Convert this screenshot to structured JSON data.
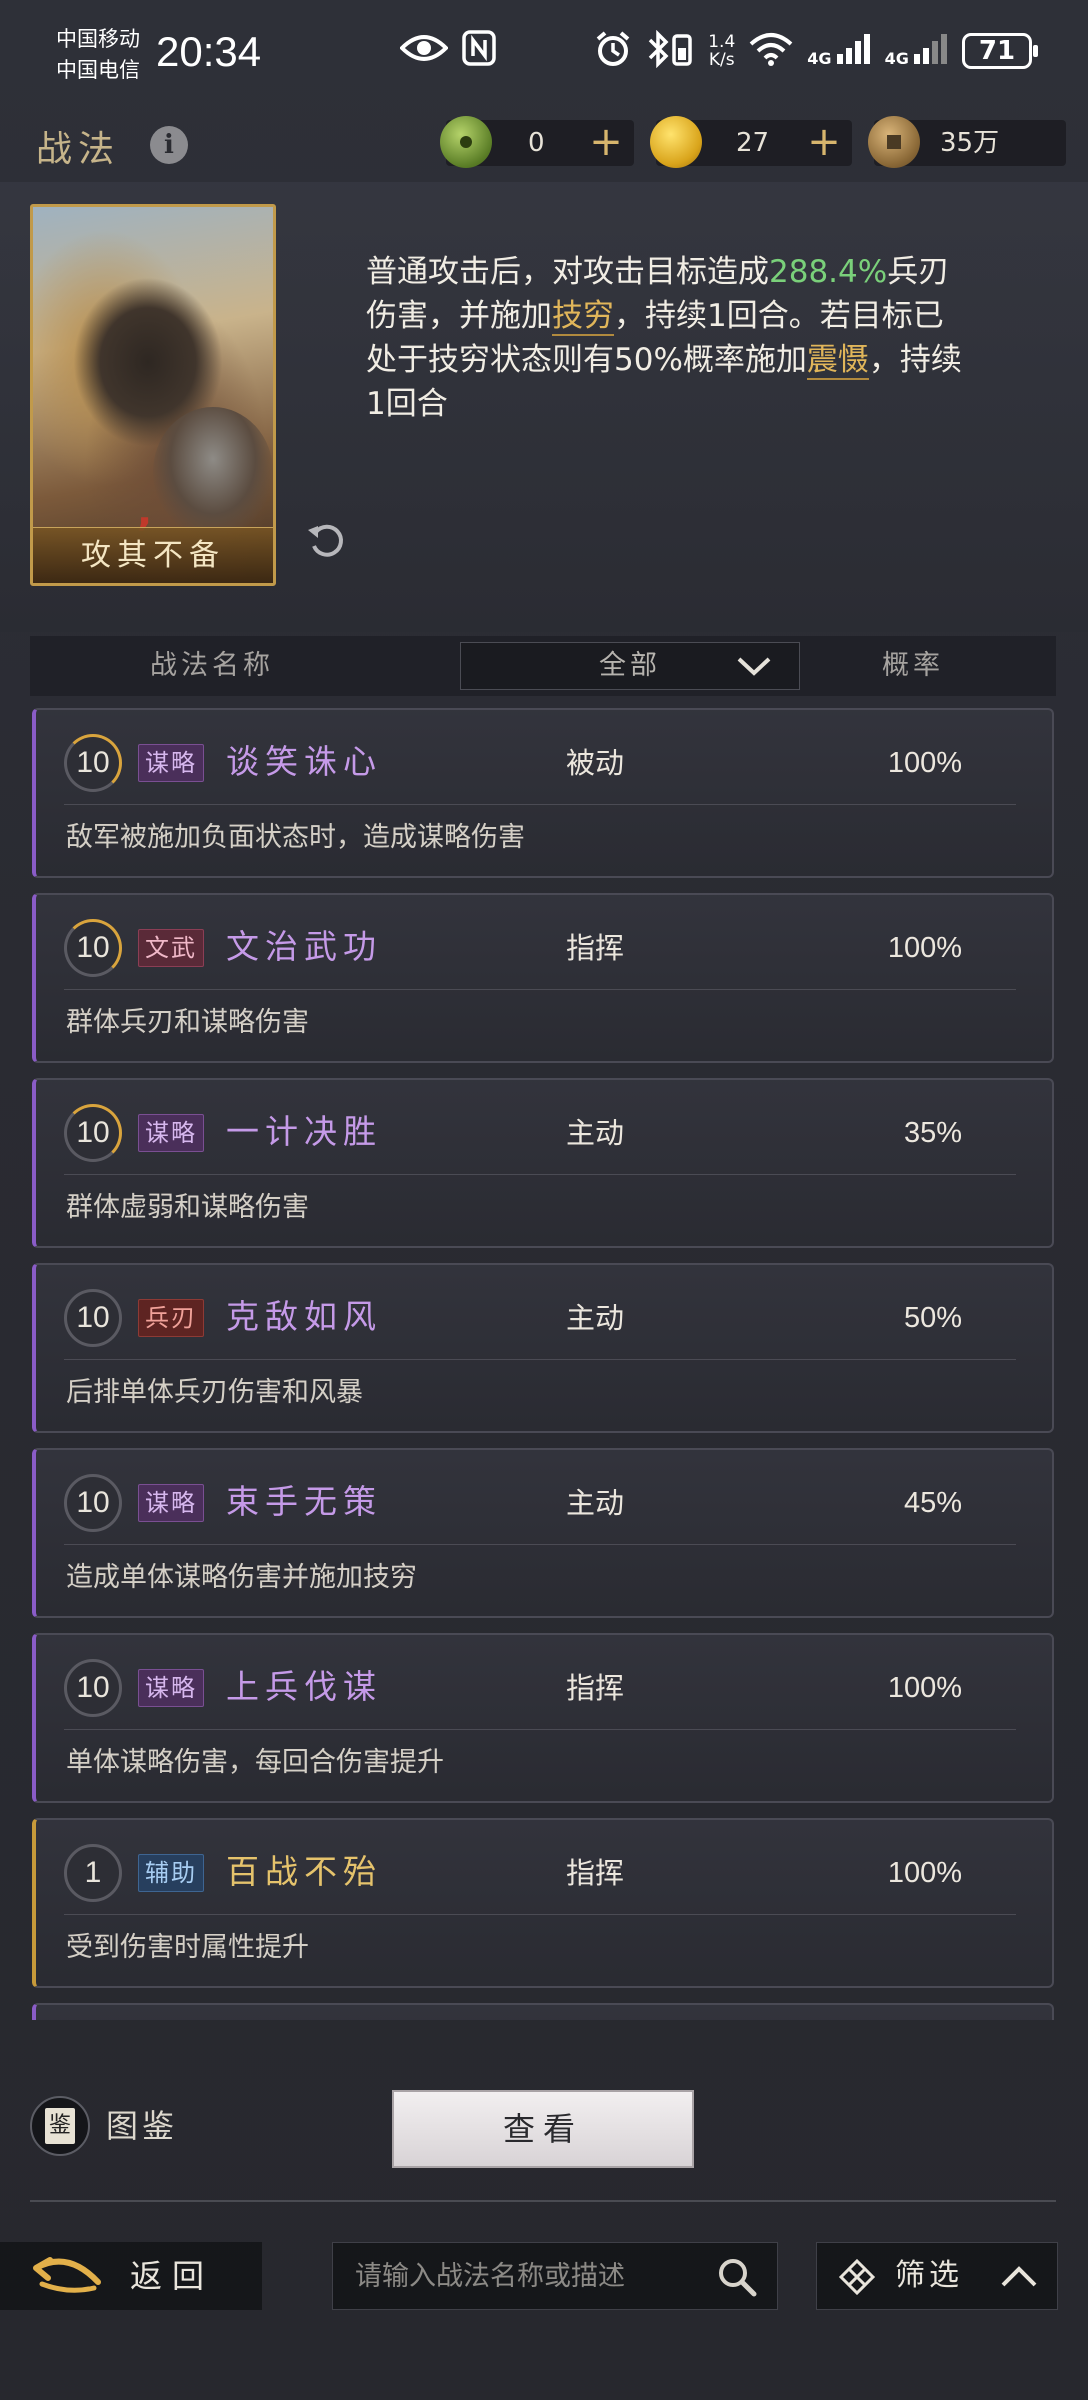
{
  "status": {
    "carrier1": "中国移动",
    "carrier2": "中国电信",
    "time": "20:34",
    "net_speed_top": "1.4",
    "net_speed_bottom": "K/s",
    "sig1": "4G",
    "sig2": "4G",
    "battery": "71"
  },
  "header": {
    "title": "战法",
    "currencies": [
      {
        "name": "jade-coin-icon",
        "value": "0"
      },
      {
        "name": "gold-coin-icon",
        "value": "27"
      },
      {
        "name": "copper-coin-icon",
        "value": "35万"
      }
    ]
  },
  "detail": {
    "card_name": "攻其不备",
    "desc_parts": [
      "普通攻击后，对攻击目标造成",
      "288.4%",
      "兵刃伤害，并施加",
      "技穷",
      "，持续1回合。若目标已处于技穷状态则有50%概率施加",
      "震慑",
      "，持续1回合"
    ]
  },
  "list_header": {
    "name_col": "战法名称",
    "filter": "全部",
    "rate_col": "概率"
  },
  "skills": [
    {
      "level": "10",
      "tag": "谋略",
      "name": "谈笑诛心",
      "type": "被动",
      "rate": "100%",
      "desc": "敌军被施加负面状态时，造成谋略伤害"
    },
    {
      "level": "10",
      "tag": "文武",
      "name": "文治武功",
      "type": "指挥",
      "rate": "100%",
      "desc": "群体兵刃和谋略伤害"
    },
    {
      "level": "10",
      "tag": "谋略",
      "name": "一计决胜",
      "type": "主动",
      "rate": "35%",
      "desc": "群体虚弱和谋略伤害"
    },
    {
      "level": "10",
      "tag": "兵刃",
      "name": "克敌如风",
      "type": "主动",
      "rate": "50%",
      "desc": "后排单体兵刃伤害和风暴"
    },
    {
      "level": "10",
      "tag": "谋略",
      "name": "束手无策",
      "type": "主动",
      "rate": "45%",
      "desc": "造成单体谋略伤害并施加技穷"
    },
    {
      "level": "10",
      "tag": "谋略",
      "name": "上兵伐谋",
      "type": "指挥",
      "rate": "100%",
      "desc": "单体谋略伤害，每回合伤害提升"
    },
    {
      "level": "1",
      "tag": "辅助",
      "name": "百战不殆",
      "type": "指挥",
      "rate": "100%",
      "desc": "受到伤害时属性提升"
    }
  ],
  "bottom": {
    "codex_label": "图鉴",
    "view_button": "查看",
    "back_label": "返回",
    "search_placeholder": "请输入战法名称或描述",
    "filter_label": "筛选"
  },
  "colors": {
    "accent_gold": "#c6b48a",
    "highlight_green": "#7ad07a",
    "highlight_gold": "#e1b65a",
    "skill_purple": "#c59ae8",
    "skill_gold": "#e5c36c"
  }
}
